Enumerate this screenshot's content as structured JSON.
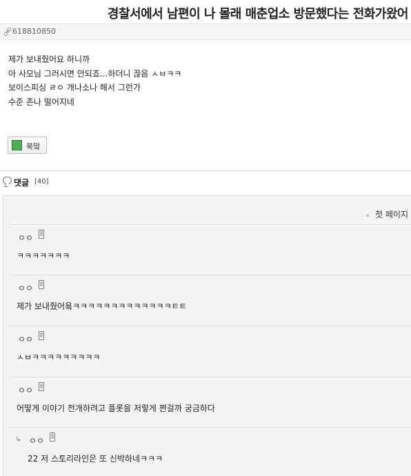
{
  "post": {
    "title": "경찰서에서 남편이 나 몰래 매춘업소 방문했다는 전화가왔어",
    "url": "618810850",
    "body_lines": [
      "제가 보내줬어요 하니까",
      "아 사모님 그러시면 안되죠...하더니 끊음 ㅅㅂㅋㅋ",
      "보이스피싱 ㄹㅇ 개나소나 해서 그런가",
      "수준 존나 떨어지네"
    ]
  },
  "bookmark": {
    "label": "북맠",
    "color": "#4caf50"
  },
  "comments_section": {
    "label": "댓글",
    "count": "[40]",
    "first_page": "첫 페이지",
    "items": [
      {
        "author": "ㅇㅇ",
        "text": "ㅋㅋㅋㅋㅋㅋㅋ"
      },
      {
        "author": "ㅇㅇ",
        "text": "제가 보내줬어욬ㅋㅋㅋㅋㅋㅋㅋㅋㅋㅋㅋㅋㅋㅌㅌ"
      },
      {
        "author": "ㅇㅇ",
        "text": "ㅅㅂㅋㅋㅋㅋㅋㅋㅋㅋㅋ"
      },
      {
        "author": "ㅇㅇ",
        "text": "어떻게 이야기 전개하려고 플롯을 저렇게 짠걸까 궁금하다"
      },
      {
        "author": "ㅇㅇ",
        "text": "22 저 스토리라인은 또 신박하네ㅋㅋㅋ",
        "reply": true
      }
    ]
  }
}
